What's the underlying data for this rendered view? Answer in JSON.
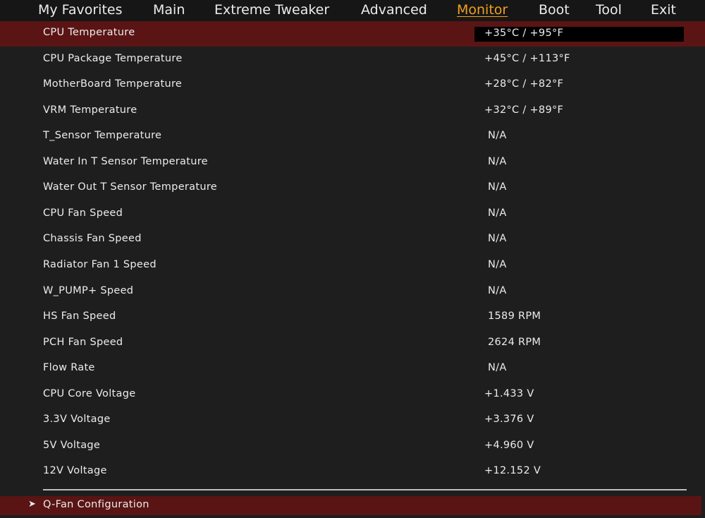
{
  "menu": {
    "items": [
      {
        "label": "My Favorites"
      },
      {
        "label": "Main"
      },
      {
        "label": "Extreme Tweaker"
      },
      {
        "label": "Advanced"
      },
      {
        "label": "Monitor"
      },
      {
        "label": "Boot"
      },
      {
        "label": "Tool"
      },
      {
        "label": "Exit"
      }
    ],
    "active": "Monitor"
  },
  "rows": [
    {
      "label": "CPU Temperature",
      "value": "+35°C / +95°F"
    },
    {
      "label": "CPU Package Temperature",
      "value": "+45°C / +113°F"
    },
    {
      "label": "MotherBoard Temperature",
      "value": "+28°C / +82°F"
    },
    {
      "label": "VRM Temperature",
      "value": "+32°C / +89°F"
    },
    {
      "label": "T_Sensor Temperature",
      "value": "N/A"
    },
    {
      "label": "Water In T Sensor Temperature",
      "value": "N/A"
    },
    {
      "label": "Water Out T Sensor Temperature",
      "value": "N/A"
    },
    {
      "label": "CPU Fan Speed",
      "value": "N/A"
    },
    {
      "label": "Chassis Fan Speed",
      "value": "N/A"
    },
    {
      "label": "Radiator Fan 1 Speed",
      "value": "N/A"
    },
    {
      "label": "W_PUMP+ Speed",
      "value": "N/A"
    },
    {
      "label": "HS Fan Speed",
      "value": "1589 RPM"
    },
    {
      "label": "PCH Fan Speed",
      "value": "2624 RPM"
    },
    {
      "label": "Flow Rate",
      "value": "N/A"
    },
    {
      "label": "CPU Core Voltage",
      "value": "+1.433 V"
    },
    {
      "label": "3.3V Voltage",
      "value": "+3.376 V"
    },
    {
      "label": "5V Voltage",
      "value": "+4.960 V"
    },
    {
      "label": "12V Voltage",
      "value": "+12.152 V"
    }
  ],
  "submenu": {
    "arrow": "➤",
    "label": "Q-Fan Configuration"
  },
  "colors": {
    "background": "#1e1e1e",
    "selected_row": "#5a1414",
    "active_menu": "#f0a020",
    "text": "#ececec"
  }
}
